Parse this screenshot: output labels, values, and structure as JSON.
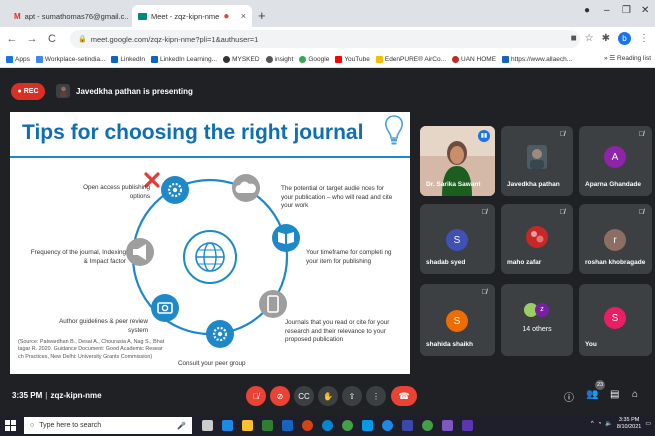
{
  "browser": {
    "tabs": [
      {
        "title": "apt - sumathomas76@gmail.c...",
        "active": false
      },
      {
        "title": "Meet - zqz-kipn-nme",
        "active": true
      }
    ],
    "new_tab": "+",
    "url": "meet.google.com/zqz-kipn-nme?pli=1&authuser=1",
    "bookmarks": [
      "Apps",
      "Workplace-setindia...",
      "LinkedIn",
      "LinkedIn Learning...",
      "MYSKED",
      "insight",
      "Google",
      "YouTube",
      "EdenPURE® AirCo...",
      "UAN HOME",
      "https://www.allaech..."
    ],
    "reading_list": "Reading list",
    "profile_initial": "b"
  },
  "meet": {
    "rec_label": "REC",
    "presenter_text": "Javedkha pathan is presenting",
    "slide": {
      "title": "Tips for choosing the right journal",
      "labels": {
        "open_access": "Open access publishing options",
        "potential": "The potential or target audie nces for your publication – who will read and cite your work",
        "frequency": "Frequency of the journal, Indexing & Impact factor",
        "timeframe": "Your timeframe for completi ng your item for publishing",
        "author_guidelines": "Author guidelines & peer review system",
        "journals_read": "Journals that you read or cite for your research and their relevance to your proposed publication",
        "peer_group": "Consult your peer group",
        "source": "(Source: Patwardhan B., Desai A., Chourasia A, Nag S., Bhat tagar R. 2020. Guidance Document: Good Academic Resear ch Practices, New Delhi: University Grants Commission)"
      }
    },
    "participants": [
      {
        "name": "Dr. Sarika Sawant",
        "type": "video",
        "color": "#c8a898"
      },
      {
        "name": "Javedkha pathan",
        "type": "photo",
        "color": "#3c4043"
      },
      {
        "name": "Aparna Ghandade",
        "type": "initial",
        "initial": "A",
        "color": "#8e24aa"
      },
      {
        "name": "shadab syed",
        "type": "initial",
        "initial": "S",
        "color": "#3f51b5"
      },
      {
        "name": "maho zafar",
        "type": "photo",
        "color": "#c62828"
      },
      {
        "name": "roshan khobragade",
        "type": "initial",
        "initial": "r",
        "color": "#8d6e63"
      },
      {
        "name": "shahida shaikh",
        "type": "initial",
        "initial": "S",
        "color": "#ef6c00"
      },
      {
        "name": "14 others",
        "type": "group",
        "initial": "z",
        "color": "#7b1fa2"
      },
      {
        "name": "You",
        "type": "initial",
        "initial": "S",
        "color": "#e91e63"
      }
    ],
    "bottom": {
      "time": "3:35 PM",
      "meeting_code": "zqz-kipn-nme",
      "participant_count": "23"
    }
  },
  "taskbar": {
    "search_placeholder": "Type here to search",
    "time": "3:35 PM",
    "date": "8/10/2021"
  },
  "colors": {
    "meet_bg": "#202124",
    "tile_bg": "#3c4043",
    "red": "#ea4335",
    "slide_title": "#0f6fb5",
    "cycle_blue": "#1e88c8"
  }
}
